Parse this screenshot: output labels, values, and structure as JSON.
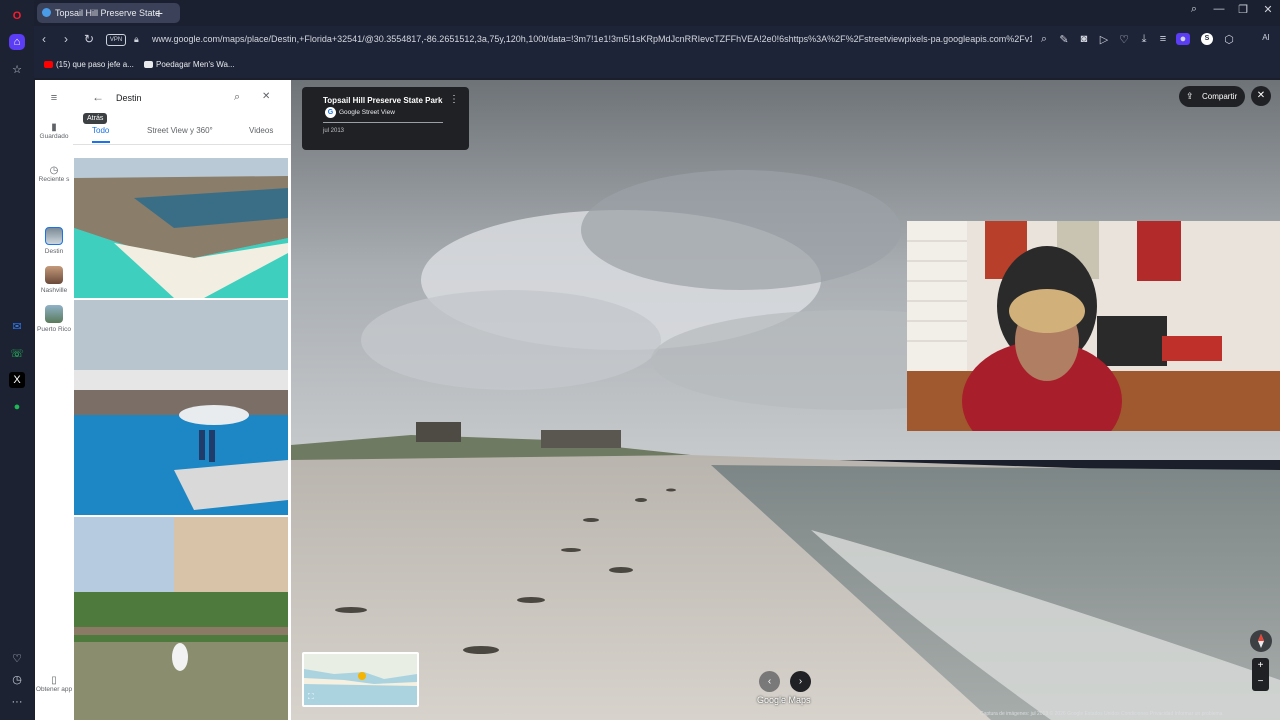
{
  "browser": {
    "tab_title": "Topsail Hill Preserve State",
    "url": "www.google.com/maps/place/Destin,+Florida+32541/@30.3554817,-86.2651512,3a,75y,120h,100t/data=!3m7!1e1!3m5!1sKRpMdJcnRRIevcTZFFhVEA!2e0!6shttps%3A%2F%2Fstreetviewpixels-pa.googleapis.com%2Fv1%2Fthumbnail%3",
    "vpn_label": "VPN",
    "ai_label": "AI",
    "bookmarks": [
      {
        "label": "(15) que paso jefe a..."
      },
      {
        "label": "Poedagar Men's Wa..."
      }
    ]
  },
  "maps_nav": {
    "saved_label": "Guardado",
    "recent_label": "Reciente s",
    "places": [
      {
        "label": "Destin"
      },
      {
        "label": "Nashville"
      },
      {
        "label": "Puerto Rico"
      }
    ],
    "get_app_label": "Obtener app"
  },
  "panel": {
    "search_value": "Destin",
    "tooltip": "Atrás",
    "tabs": [
      {
        "label": "Todo"
      },
      {
        "label": "Street View y 360°"
      },
      {
        "label": "Videos"
      }
    ]
  },
  "streetview": {
    "place_title": "Topsail Hill Preserve State Park",
    "source": "Google Street View",
    "date": "jul 2013",
    "share_label": "Compartir",
    "brand": "Google Maps",
    "footer": "Captura de imágenes: jul 2013   © 2026 Google   Estados Unidos   Condiciones   Privacidad   Informar un problema"
  },
  "colors": {
    "accent": "#1a73e8",
    "browser_bg": "#1b1f2b"
  }
}
